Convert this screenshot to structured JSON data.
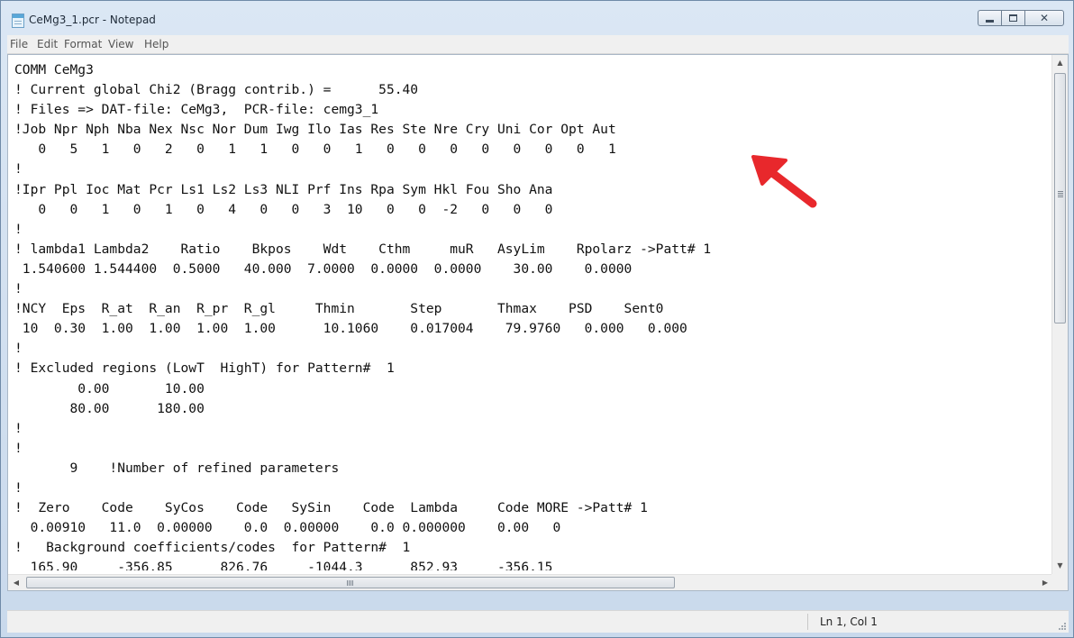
{
  "window": {
    "title": "CeMg3_1.pcr - Notepad"
  },
  "menu": {
    "items": [
      "File",
      "Edit",
      "Format",
      "View",
      "Help"
    ]
  },
  "editor": {
    "lines": [
      "COMM CeMg3",
      "! Current global Chi2 (Bragg contrib.) =      55.40",
      "! Files => DAT-file: CeMg3,  PCR-file: cemg3_1",
      "!Job Npr Nph Nba Nex Nsc Nor Dum Iwg Ilo Ias Res Ste Nre Cry Uni Cor Opt Aut",
      "   0   5   1   0   2   0   1   1   0   0   1   0   0   0   0   0   0   0   1",
      "!",
      "!Ipr Ppl Ioc Mat Pcr Ls1 Ls2 Ls3 NLI Prf Ins Rpa Sym Hkl Fou Sho Ana",
      "   0   0   1   0   1   0   4   0   0   3  10   0   0  -2   0   0   0",
      "!",
      "! lambda1 Lambda2    Ratio    Bkpos    Wdt    Cthm     muR   AsyLim    Rpolarz ->Patt# 1",
      " 1.540600 1.544400  0.5000   40.000  7.0000  0.0000  0.0000    30.00    0.0000",
      "!",
      "!NCY  Eps  R_at  R_an  R_pr  R_gl     Thmin       Step       Thmax    PSD    Sent0",
      " 10  0.30  1.00  1.00  1.00  1.00      10.1060    0.017004    79.9760   0.000   0.000",
      "!",
      "! Excluded regions (LowT  HighT) for Pattern#  1",
      "        0.00       10.00",
      "       80.00      180.00",
      "!",
      "!",
      "       9    !Number of refined parameters",
      "!",
      "!  Zero    Code    SyCos    Code   SySin    Code  Lambda     Code MORE ->Patt# 1",
      "  0.00910   11.0  0.00000    0.0  0.00000    0.0 0.000000    0.00   0",
      "!   Background coefficients/codes  for Pattern#  1",
      "  165.90     -356.85      826.76     -1044.3      852.93     -356.15"
    ]
  },
  "statusbar": {
    "position": "Ln 1, Col 1"
  },
  "icons": {
    "app": "notepad-icon",
    "minimize": "minimize-icon",
    "maximize": "maximize-icon",
    "close": "close-icon"
  },
  "colors": {
    "annotation_arrow": "#e8282c",
    "title_bar": "#dbe7f4"
  }
}
